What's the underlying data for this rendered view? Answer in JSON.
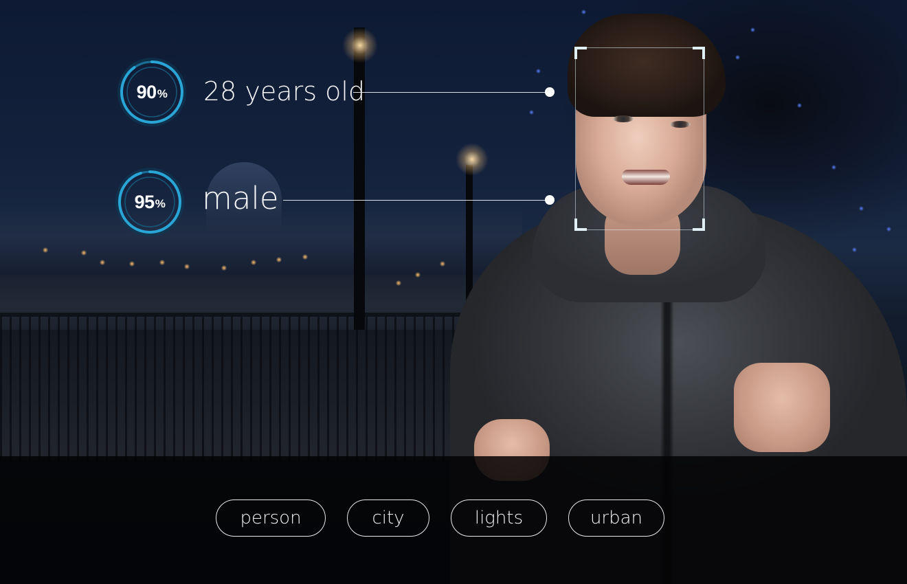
{
  "attributes": [
    {
      "confidence_value": "90",
      "confidence_unit": "%",
      "confidence_fraction": 0.9,
      "label": "28 years old"
    },
    {
      "confidence_value": "95",
      "confidence_unit": "%",
      "confidence_fraction": 0.95,
      "label": "male"
    }
  ],
  "tags": [
    "person",
    "city",
    "lights",
    "urban"
  ],
  "colors": {
    "ring_accent": "#2aa6d6",
    "ring_track": "#0d3a55",
    "connector": "#ffffff",
    "tag_border": "#e8eaec",
    "tag_bar_background": "#040405"
  }
}
